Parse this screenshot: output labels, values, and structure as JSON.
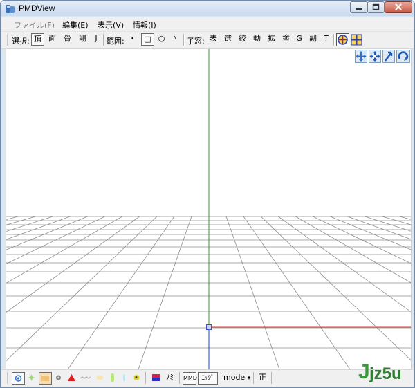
{
  "window": {
    "title": "PMDView",
    "controls": {
      "minimize": "minimize",
      "maximize": "maximize",
      "close": "close"
    }
  },
  "menubar": {
    "items": [
      {
        "label": "ファイル(F)",
        "enabled": false
      },
      {
        "label": "編集(E)",
        "enabled": true
      },
      {
        "label": "表示(V)",
        "enabled": true
      },
      {
        "label": "情報(I)",
        "enabled": true
      }
    ]
  },
  "toolbar": {
    "select_label": "選択:",
    "select_items": [
      "頂",
      "面",
      "骨",
      "剛",
      "J"
    ],
    "range_label": "範囲:",
    "range_items": [
      "・",
      "□",
      "○",
      "ㅿ"
    ],
    "child_window_label": "子窓:",
    "child_window_items": [
      "表",
      "選",
      "絞",
      "動",
      "拡",
      "塗",
      "G",
      "副",
      "T"
    ]
  },
  "bottombar": {
    "nami_label": "ﾉﾐ",
    "mmd_label": "MMD",
    "edge_label": "ｴｯｼﾞ",
    "mode_label": "mode",
    "mode_arrow": "▾",
    "sei_label": "正"
  },
  "watermark": {
    "j": "J",
    "text": "jz5u"
  },
  "colors": {
    "y_axis": "#3a9a3a",
    "x_axis": "#e53935",
    "z_axis": "#1e3fd8",
    "grid": "#8c8c8c"
  }
}
